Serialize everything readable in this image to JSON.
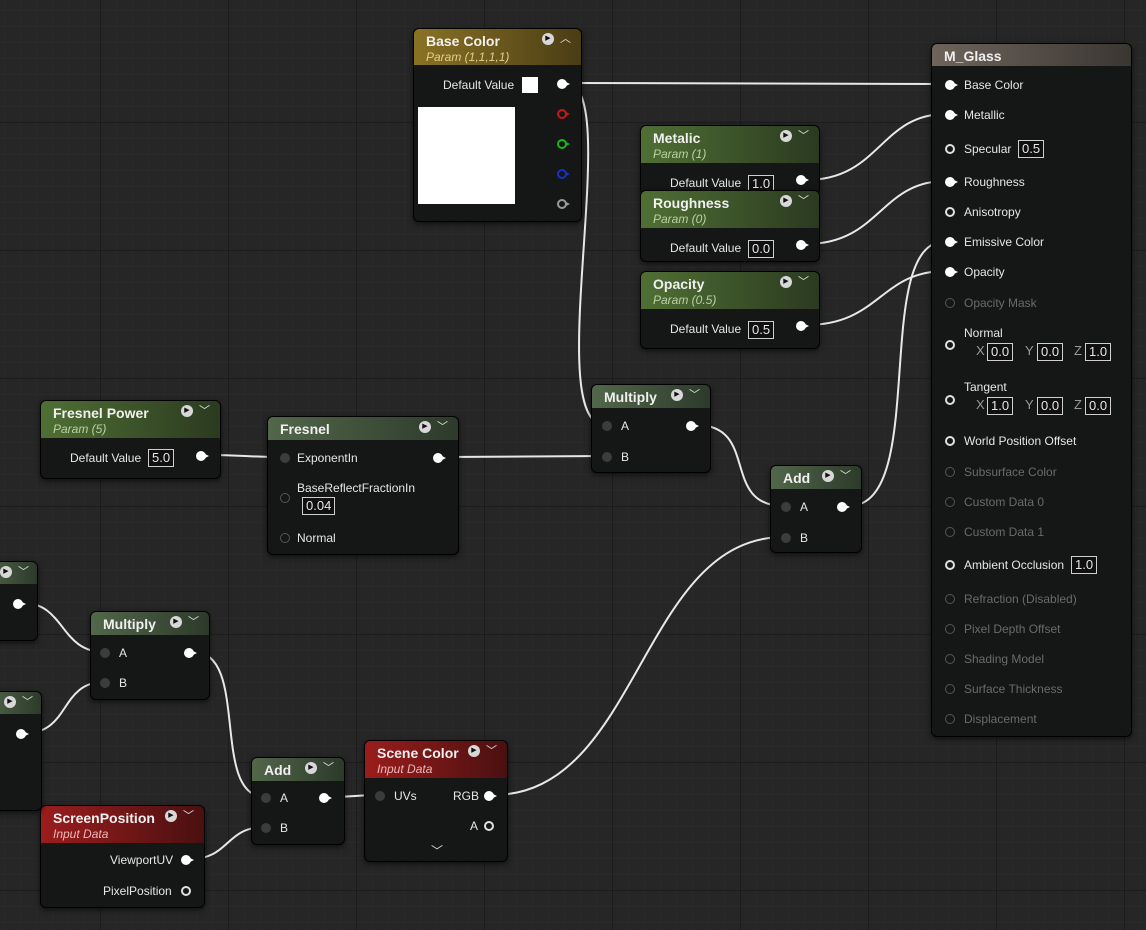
{
  "nodes": {
    "base_color": {
      "title": "Base Color",
      "subtitle": "Param (1,1,1,1)",
      "default_label": "Default Value",
      "color": "#ffffff"
    },
    "metalic": {
      "title": "Metalic",
      "subtitle": "Param (1)",
      "default_label": "Default Value",
      "value": "1.0"
    },
    "roughness": {
      "title": "Roughness",
      "subtitle": "Param (0)",
      "default_label": "Default Value",
      "value": "0.0"
    },
    "opacity": {
      "title": "Opacity",
      "subtitle": "Param (0.5)",
      "default_label": "Default Value",
      "value": "0.5"
    },
    "fresnel_power": {
      "title": "Fresnel Power",
      "subtitle": "Param (5)",
      "default_label": "Default Value",
      "value": "5.0"
    },
    "fresnel": {
      "title": "Fresnel",
      "pin_exponent": "ExponentIn",
      "pin_base_reflect": "BaseReflectFractionIn",
      "base_reflect_value": "0.04",
      "pin_normal": "Normal"
    },
    "multiply_top": {
      "title": "Multiply",
      "pin_a": "A",
      "pin_b": "B"
    },
    "add_top": {
      "title": "Add",
      "pin_a": "A",
      "pin_b": "B"
    },
    "multiply_bottom": {
      "title": "Multiply",
      "pin_a": "A",
      "pin_b": "B"
    },
    "add_bottom": {
      "title": "Add",
      "pin_a": "A",
      "pin_b": "B"
    },
    "scene_color": {
      "title": "Scene Color",
      "subtitle": "Input Data",
      "pin_uvs": "UVs",
      "pin_rgb": "RGB",
      "pin_a": "A"
    },
    "screen_position": {
      "title": "ScreenPosition",
      "subtitle": "Input Data",
      "pin_viewport_uv": "ViewportUV",
      "pin_pixel_position": "PixelPosition"
    }
  },
  "material": {
    "title": "M_Glass",
    "pins": {
      "base_color": "Base Color",
      "metallic": "Metallic",
      "specular": "Specular",
      "specular_value": "0.5",
      "roughness": "Roughness",
      "anisotropy": "Anisotropy",
      "emissive_color": "Emissive Color",
      "opacity": "Opacity",
      "opacity_mask": "Opacity Mask",
      "normal": "Normal",
      "normal_x": "0.0",
      "normal_y": "0.0",
      "normal_z": "1.0",
      "tangent": "Tangent",
      "tangent_x": "1.0",
      "tangent_y": "0.0",
      "tangent_z": "0.0",
      "world_position_offset": "World Position Offset",
      "subsurface_color": "Subsurface Color",
      "custom_data_0": "Custom Data 0",
      "custom_data_1": "Custom Data 1",
      "ambient_occlusion": "Ambient Occlusion",
      "ambient_occlusion_value": "1.0",
      "refraction": "Refraction (Disabled)",
      "pixel_depth_offset": "Pixel Depth Offset",
      "shading_model": "Shading Model",
      "surface_thickness": "Surface Thickness",
      "displacement": "Displacement"
    },
    "axis": {
      "x": "X",
      "y": "Y",
      "z": "Z"
    }
  },
  "colors": {
    "param_header": "#4f6f34",
    "vector_param_header": "#8a7224",
    "input_data_header": "#9b1d1d",
    "operator_header": "#52674a",
    "output_header": "#6e645b",
    "wire": "#e8e8e8",
    "grid_background": "#262626"
  },
  "icons": {
    "preview_toggle": "play-circle-icon",
    "collapse": "chevron-down-icon",
    "collapse_up": "chevron-up-icon",
    "advanced_expand": "chevron-down-icon"
  }
}
